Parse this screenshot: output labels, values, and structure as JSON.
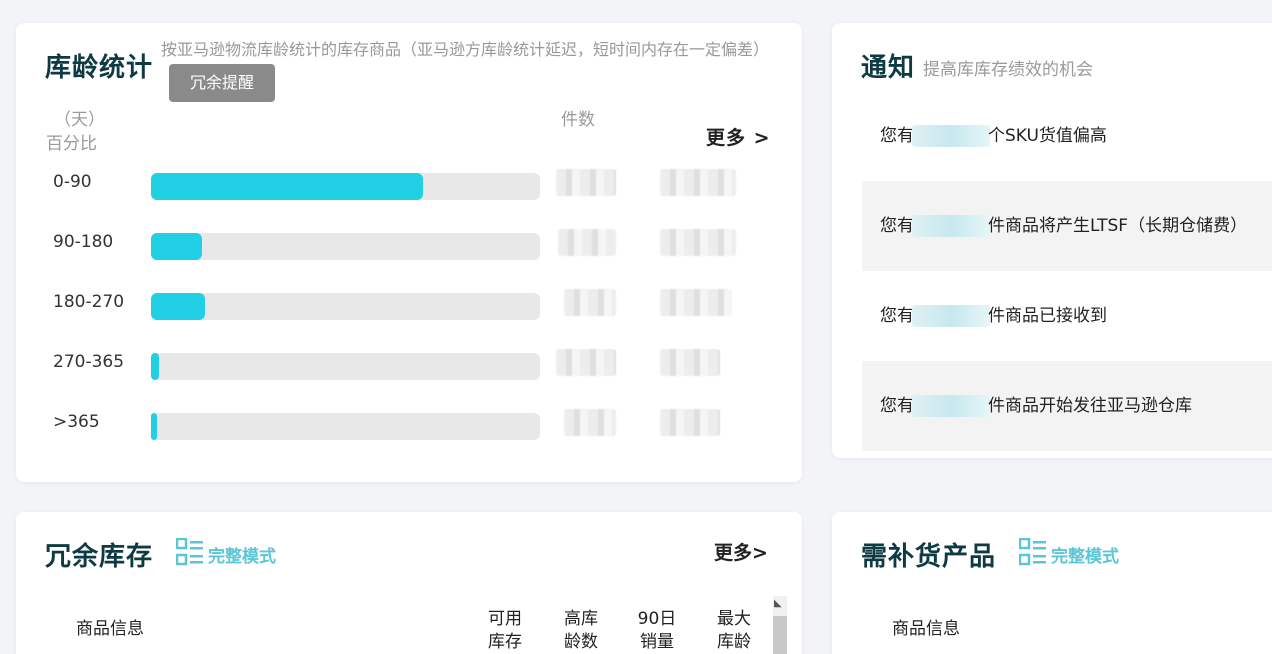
{
  "age_stats": {
    "title": "库龄统计",
    "description": "按亚马逊物流库龄统计的库存商品（亚马逊方库龄统计延迟，短时间内存在一定偏差）",
    "redundant_alert_label": "冗余提醒",
    "col_days": "（天）",
    "col_percent": "百分比",
    "col_count": "件数",
    "more_label": "更多 >",
    "rows": [
      {
        "label": "0-90",
        "fill_percent": 70
      },
      {
        "label": "90-180",
        "fill_percent": 13
      },
      {
        "label": "180-270",
        "fill_percent": 14
      },
      {
        "label": "270-365",
        "fill_percent": 2
      },
      {
        "label": ">365",
        "fill_percent": 1
      }
    ]
  },
  "notice": {
    "title": "通知",
    "subtitle": "提高库库存绩效的机会",
    "items": [
      {
        "prefix": "您有",
        "suffix": "个SKU货值偏高"
      },
      {
        "prefix": "您有",
        "suffix": "件商品将产生LTSF（长期仓储费）"
      },
      {
        "prefix": "您有",
        "suffix": "件商品已接收到"
      },
      {
        "prefix": "您有",
        "suffix": "件商品开始发往亚马逊仓库"
      }
    ]
  },
  "redundant_inventory": {
    "title": "冗余库存",
    "mode_label": "完整模式",
    "more_label": "更多>",
    "columns": [
      "商品信息",
      "可用库存",
      "高库龄数",
      "90日销量",
      "最大库龄"
    ]
  },
  "restock": {
    "title": "需补货产品",
    "mode_label": "完整模式",
    "columns": [
      "商品信息"
    ]
  },
  "colors": {
    "accent": "#22d0e6",
    "title": "#0e3a44",
    "mode_link": "#5bc6d6"
  }
}
